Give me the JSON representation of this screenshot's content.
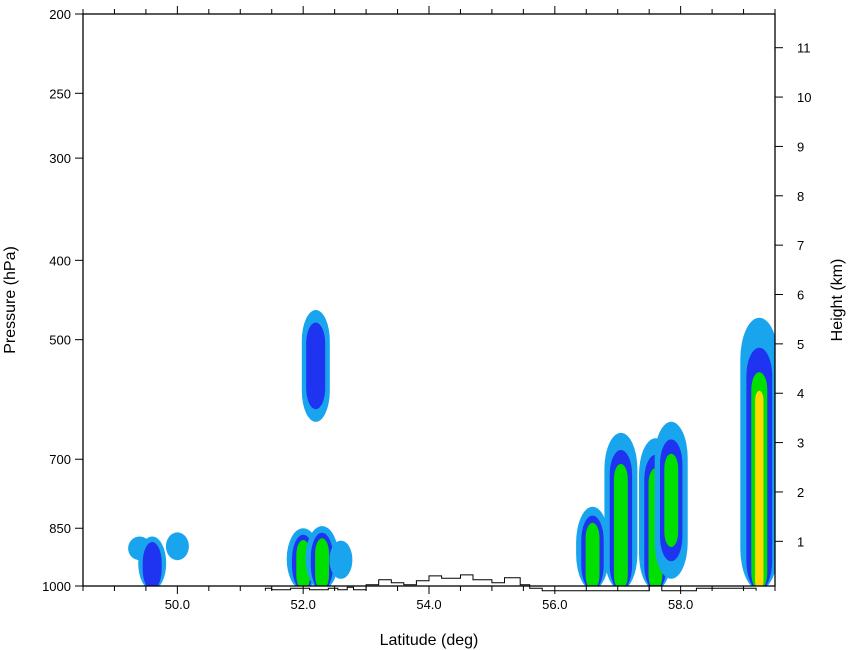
{
  "chart_data": {
    "type": "contour",
    "title": "",
    "xlabel": "Latitude (deg)",
    "ylabel_left": "Pressure (hPa)",
    "ylabel_right": "Height (km)",
    "x_ticks": [
      {
        "value": 50,
        "label": "50.0"
      },
      {
        "value": 52,
        "label": "52.0"
      },
      {
        "value": 54,
        "label": "54.0"
      },
      {
        "value": 56,
        "label": "56.0"
      },
      {
        "value": 58,
        "label": "58.0"
      }
    ],
    "xlim": [
      48.5,
      59.5
    ],
    "pressure_ticks": [
      {
        "value": 200,
        "label": "200"
      },
      {
        "value": 250,
        "label": "250"
      },
      {
        "value": 300,
        "label": "300"
      },
      {
        "value": 400,
        "label": "400"
      },
      {
        "value": 500,
        "label": "500"
      },
      {
        "value": 700,
        "label": "700"
      },
      {
        "value": 850,
        "label": "850"
      },
      {
        "value": 1000,
        "label": "1000"
      }
    ],
    "ylim_pressure": [
      1000,
      200
    ],
    "y_scale": "log pressure",
    "height_ticks": [
      {
        "value": 1,
        "label": "1"
      },
      {
        "value": 2,
        "label": "2"
      },
      {
        "value": 3,
        "label": "3"
      },
      {
        "value": 4,
        "label": "4"
      },
      {
        "value": 5,
        "label": "5"
      },
      {
        "value": 6,
        "label": "6"
      },
      {
        "value": 7,
        "label": "7"
      },
      {
        "value": 8,
        "label": "8"
      },
      {
        "value": 9,
        "label": "9"
      },
      {
        "value": 10,
        "label": "10"
      },
      {
        "value": 11,
        "label": "11"
      }
    ],
    "grid": false,
    "legend": "none",
    "contour_colors": [
      "#19a5ee",
      "#1e34f0",
      "#00e000",
      "#ffd800"
    ],
    "outline_color": "#000000",
    "cells": [
      {
        "lat": 49.4,
        "p_top": 870,
        "p_bottom": 930,
        "levels": 1
      },
      {
        "lat": 49.6,
        "p_top": 870,
        "p_bottom": 1000,
        "levels": 2
      },
      {
        "lat": 50.0,
        "p_top": 860,
        "p_bottom": 930,
        "levels": 1
      },
      {
        "lat": 52.2,
        "p_top": 460,
        "p_bottom": 630,
        "levels": 2
      },
      {
        "lat": 52.0,
        "p_top": 850,
        "p_bottom": 1000,
        "levels": 3
      },
      {
        "lat": 52.3,
        "p_top": 845,
        "p_bottom": 1000,
        "levels": 3
      },
      {
        "lat": 52.6,
        "p_top": 880,
        "p_bottom": 980,
        "levels": 1
      },
      {
        "lat": 56.6,
        "p_top": 800,
        "p_bottom": 1000,
        "levels": 3
      },
      {
        "lat": 57.05,
        "p_top": 650,
        "p_bottom": 1000,
        "levels": 3
      },
      {
        "lat": 57.6,
        "p_top": 660,
        "p_bottom": 1000,
        "levels": 3
      },
      {
        "lat": 57.85,
        "p_top": 630,
        "p_bottom": 980,
        "levels": 3
      },
      {
        "lat": 59.25,
        "p_top": 470,
        "p_bottom": 1000,
        "levels": 4
      }
    ],
    "terrain_profile": [
      [
        51.4,
        0.0
      ],
      [
        51.4,
        0.05
      ],
      [
        51.5,
        0.05
      ],
      [
        51.5,
        0.02
      ],
      [
        51.8,
        0.02
      ],
      [
        51.8,
        0.05
      ],
      [
        52.1,
        0.05
      ],
      [
        52.1,
        0.02
      ],
      [
        52.4,
        0.02
      ],
      [
        52.4,
        0.05
      ],
      [
        52.55,
        0.05
      ],
      [
        52.55,
        0.02
      ],
      [
        52.7,
        0.02
      ],
      [
        52.7,
        0.07
      ],
      [
        52.8,
        0.07
      ],
      [
        52.8,
        0.02
      ],
      [
        53.0,
        0.02
      ],
      [
        53.0,
        0.12
      ],
      [
        53.2,
        0.12
      ],
      [
        53.2,
        0.22
      ],
      [
        53.4,
        0.22
      ],
      [
        53.4,
        0.16
      ],
      [
        53.6,
        0.16
      ],
      [
        53.6,
        0.12
      ],
      [
        53.8,
        0.12
      ],
      [
        53.8,
        0.2
      ],
      [
        54.0,
        0.2
      ],
      [
        54.0,
        0.3
      ],
      [
        54.2,
        0.3
      ],
      [
        54.2,
        0.25
      ],
      [
        54.5,
        0.25
      ],
      [
        54.5,
        0.32
      ],
      [
        54.7,
        0.32
      ],
      [
        54.7,
        0.22
      ],
      [
        55.0,
        0.22
      ],
      [
        55.0,
        0.16
      ],
      [
        55.2,
        0.16
      ],
      [
        55.2,
        0.26
      ],
      [
        55.45,
        0.26
      ],
      [
        55.45,
        0.12
      ],
      [
        55.6,
        0.12
      ],
      [
        55.6,
        0.05
      ],
      [
        55.8,
        0.05
      ],
      [
        55.8,
        0.0
      ],
      [
        57.5,
        0.0
      ],
      [
        57.5,
        0.1
      ],
      [
        57.7,
        0.1
      ],
      [
        57.7,
        0.0
      ],
      [
        58.25,
        0.0
      ],
      [
        58.25,
        0.05
      ],
      [
        59.2,
        0.05
      ],
      [
        59.2,
        0.0
      ]
    ]
  }
}
